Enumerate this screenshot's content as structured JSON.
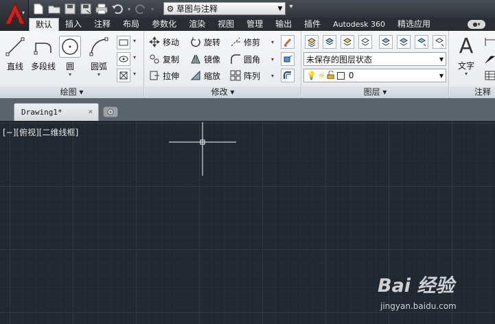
{
  "workspace": {
    "name": "草图与注释"
  },
  "tabs": [
    "默认",
    "插入",
    "注释",
    "布局",
    "参数化",
    "渲染",
    "视图",
    "管理",
    "输出",
    "插件",
    "Autodesk 360",
    "精选应用"
  ],
  "ribbon": {
    "draw": {
      "title": "绘图",
      "line": "直线",
      "polyline": "多段线",
      "circle": "圆",
      "arc": "圆弧"
    },
    "modify": {
      "title": "修改",
      "move": "移动",
      "rotate": "旋转",
      "trim": "修剪",
      "copy": "复制",
      "mirror": "镜像",
      "fillet": "圆角",
      "stretch": "拉伸",
      "scale": "缩放",
      "array": "阵列"
    },
    "layers": {
      "title": "图层",
      "layer_state": "未保存的图层状态",
      "current_layer": "0"
    },
    "annotation": {
      "title": "注释",
      "text": "文字"
    }
  },
  "file_tab": {
    "name": "Drawing1*",
    "close": "×"
  },
  "viewport": {
    "label": "[−][俯视][二维线框]"
  },
  "watermark": {
    "logo": "Bai 经验",
    "url": "jingyan.baidu.com"
  },
  "colors": {
    "canvas": "#212832",
    "ribbon": "#eef0f2",
    "accent": "#c8231c"
  }
}
